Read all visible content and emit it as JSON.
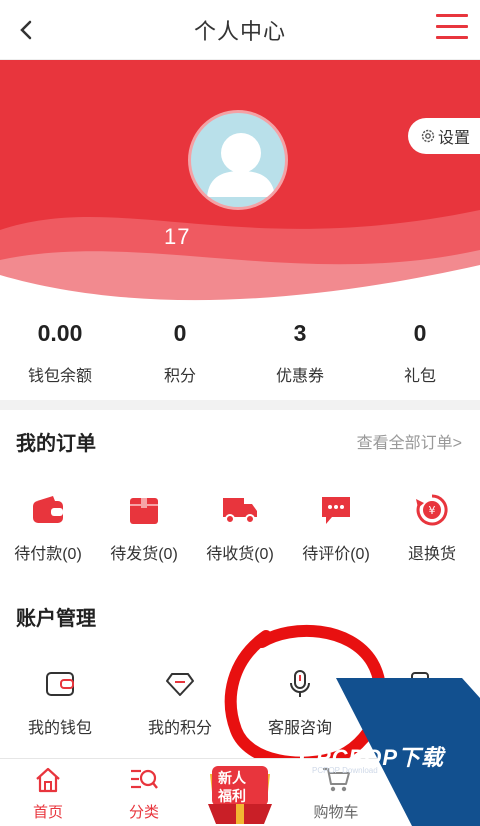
{
  "header": {
    "title": "个人中心",
    "back_icon": "chevron-left-icon",
    "menu_icon": "hamburger-icon"
  },
  "profile": {
    "username": "17",
    "settings_label": "设置"
  },
  "stats": [
    {
      "value": "0.00",
      "label": "钱包余额"
    },
    {
      "value": "0",
      "label": "积分"
    },
    {
      "value": "3",
      "label": "优惠券"
    },
    {
      "value": "0",
      "label": "礼包"
    }
  ],
  "orders": {
    "title": "我的订单",
    "view_all": "查看全部订单>",
    "items": [
      {
        "label": "待付款(0)",
        "icon": "wallet-icon"
      },
      {
        "label": "待发货(0)",
        "icon": "box-icon"
      },
      {
        "label": "待收货(0)",
        "icon": "truck-icon"
      },
      {
        "label": "待评价(0)",
        "icon": "chat-icon"
      },
      {
        "label": "退换货",
        "icon": "refund-icon"
      }
    ]
  },
  "account": {
    "title": "账户管理",
    "items": [
      {
        "label": "我的钱包",
        "icon": "wallet-outline-icon"
      },
      {
        "label": "我的积分",
        "icon": "diamond-icon"
      },
      {
        "label": "客服咨询",
        "icon": "microphone-icon"
      }
    ]
  },
  "tabbar": {
    "items": [
      {
        "label": "首页",
        "icon": "home-icon"
      },
      {
        "label": "分类",
        "icon": "category-search-icon"
      },
      {
        "label": "",
        "icon": "new-user-gift-icon"
      },
      {
        "label": "购物车",
        "icon": "cart-icon"
      },
      {
        "label": "",
        "icon": "user-icon"
      }
    ],
    "promo_line1": "新人",
    "promo_line2": "福利"
  },
  "watermark": {
    "text": "PCPOP下载",
    "sub": "PCPOP Download"
  },
  "colors": {
    "accent": "#e8353d",
    "background": "#f2f2f2"
  }
}
